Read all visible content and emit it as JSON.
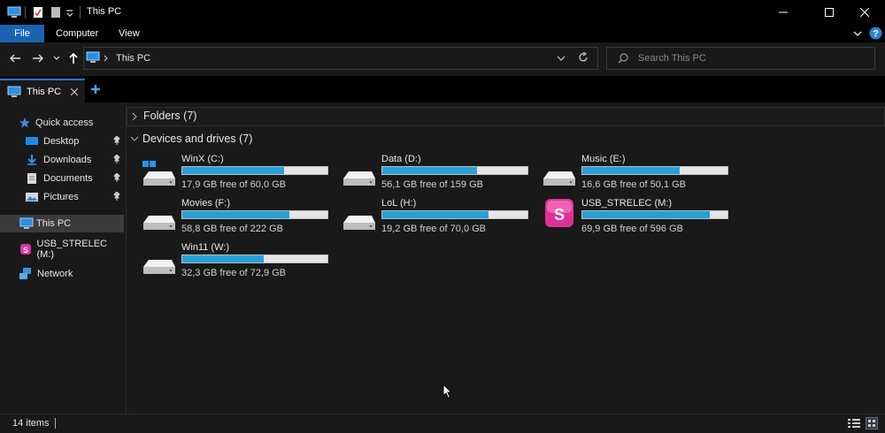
{
  "window": {
    "title": "This PC",
    "controls": {
      "minimize": "—",
      "maximize": "☐",
      "close": "✕"
    }
  },
  "ribbon": {
    "tabs": [
      "File",
      "Computer",
      "View"
    ]
  },
  "address": {
    "path": "This PC",
    "search_placeholder": "Search This PC"
  },
  "tabstrip": {
    "tab_label": "This PC",
    "add_label": "+"
  },
  "nav": {
    "quick_access": "Quick access",
    "items": [
      {
        "label": "Desktop",
        "pinned": true
      },
      {
        "label": "Downloads",
        "pinned": true
      },
      {
        "label": "Documents",
        "pinned": true
      },
      {
        "label": "Pictures",
        "pinned": true
      }
    ],
    "this_pc": "This PC",
    "usb": "USB_STRELEC (M:)",
    "network": "Network"
  },
  "content": {
    "folders_header": "Folders (7)",
    "devices_header": "Devices and drives (7)",
    "drives": [
      {
        "name": "WinX (C:)",
        "free": "17,9 GB free of 60,0 GB",
        "used_fraction": 0.7,
        "icon": "windows-drive"
      },
      {
        "name": "Data (D:)",
        "free": "56,1 GB free of 159 GB",
        "used_fraction": 0.65,
        "icon": "hdd"
      },
      {
        "name": "Music (E:)",
        "free": "16,6 GB free of 50,1 GB",
        "used_fraction": 0.67,
        "icon": "hdd"
      },
      {
        "name": "Movies (F:)",
        "free": "58,8 GB free of 222 GB",
        "used_fraction": 0.74,
        "icon": "hdd"
      },
      {
        "name": "LoL (H:)",
        "free": "19,2 GB free of 70,0 GB",
        "used_fraction": 0.73,
        "icon": "hdd"
      },
      {
        "name": "USB_STRELEC (M:)",
        "free": "69,9 GB free of 596 GB",
        "used_fraction": 0.88,
        "icon": "usb-s"
      },
      {
        "name": "Win11 (W:)",
        "free": "32,3 GB free of 72,9 GB",
        "used_fraction": 0.56,
        "icon": "hdd"
      }
    ],
    "usb_letter": "S"
  },
  "status": {
    "items_count": "14 items"
  },
  "colors": {
    "accent": "#1a63b3",
    "bar_fill": "#26a0da",
    "usb_pink": "#e0309a"
  }
}
